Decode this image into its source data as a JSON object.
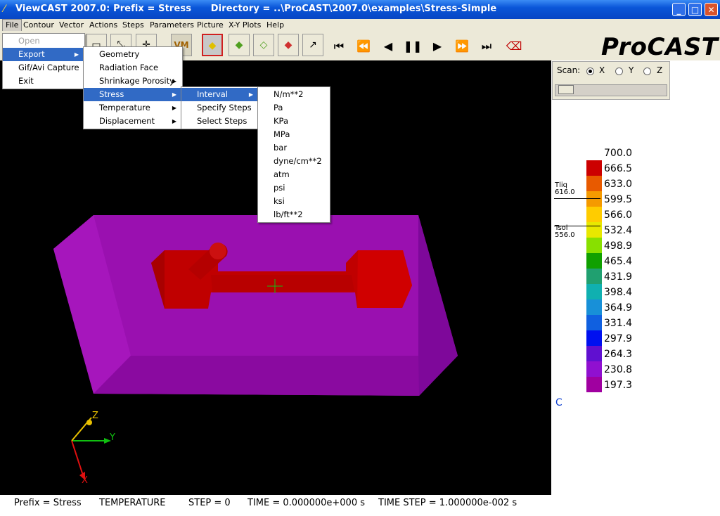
{
  "window": {
    "title": "ViewCAST 2007.0: Prefix = Stress      Directory = ..\\ProCAST\\2007.0\\examples\\Stress-Simple",
    "minimize": "_",
    "maximize": "□",
    "close": "✕"
  },
  "menubar": {
    "file": "File",
    "contour": "Contour",
    "vector": "Vector",
    "actions": "Actions",
    "steps": "Steps",
    "parameters": "Parameters",
    "picture": "Picture",
    "xy_plots": "X-Y Plots",
    "help": "Help"
  },
  "brand": "ProCAST",
  "file_menu": {
    "open": "Open",
    "export": "Export",
    "gif_avi": "Gif/Avi Capture",
    "exit": "Exit"
  },
  "export_menu": {
    "geometry": "Geometry",
    "radiation_face": "Radiation Face",
    "shrinkage_porosity": "Shrinkage Porosity",
    "stress": "Stress",
    "temperature": "Temperature",
    "displacement": "Displacement"
  },
  "stress_menu": {
    "interval": "Interval",
    "specify_steps": "Specify Steps",
    "select_steps": "Select Steps"
  },
  "units_menu": [
    "N/m**2",
    "Pa",
    "KPa",
    "MPa",
    "bar",
    "dyne/cm**2",
    "atm",
    "psi",
    "ksi",
    "lb/ft**2"
  ],
  "scan": {
    "label": "Scan:",
    "x": "X",
    "y": "Y",
    "z": "Z",
    "selected": "X"
  },
  "legend": {
    "values": [
      "700.0",
      "666.5",
      "633.0",
      "599.5",
      "566.0",
      "532.4",
      "498.9",
      "465.4",
      "431.9",
      "398.4",
      "364.9",
      "331.4",
      "297.9",
      "264.3",
      "230.8",
      "197.3"
    ],
    "colors": [
      "#cc0000",
      "#e85a00",
      "#f59a00",
      "#ffcc00",
      "#e8e800",
      "#88e000",
      "#10a000",
      "#20a070",
      "#10b0b0",
      "#1890d8",
      "#1060e0",
      "#0010f0",
      "#6010d0",
      "#9010d0",
      "#a000a0"
    ],
    "tliq_label": "Tliq",
    "tliq_value": "616.0",
    "tsol_label": "Tsol",
    "tsol_value": "556.0",
    "unit": "C"
  },
  "axes": {
    "x": "X",
    "y": "Y",
    "z": "Z"
  },
  "status": {
    "prefix": "Prefix = Stress",
    "quantity": "TEMPERATURE",
    "step": "STEP = 0",
    "time": "TIME = 0.000000e+000 s",
    "time_step": "TIME STEP = 1.000000e-002 s"
  }
}
